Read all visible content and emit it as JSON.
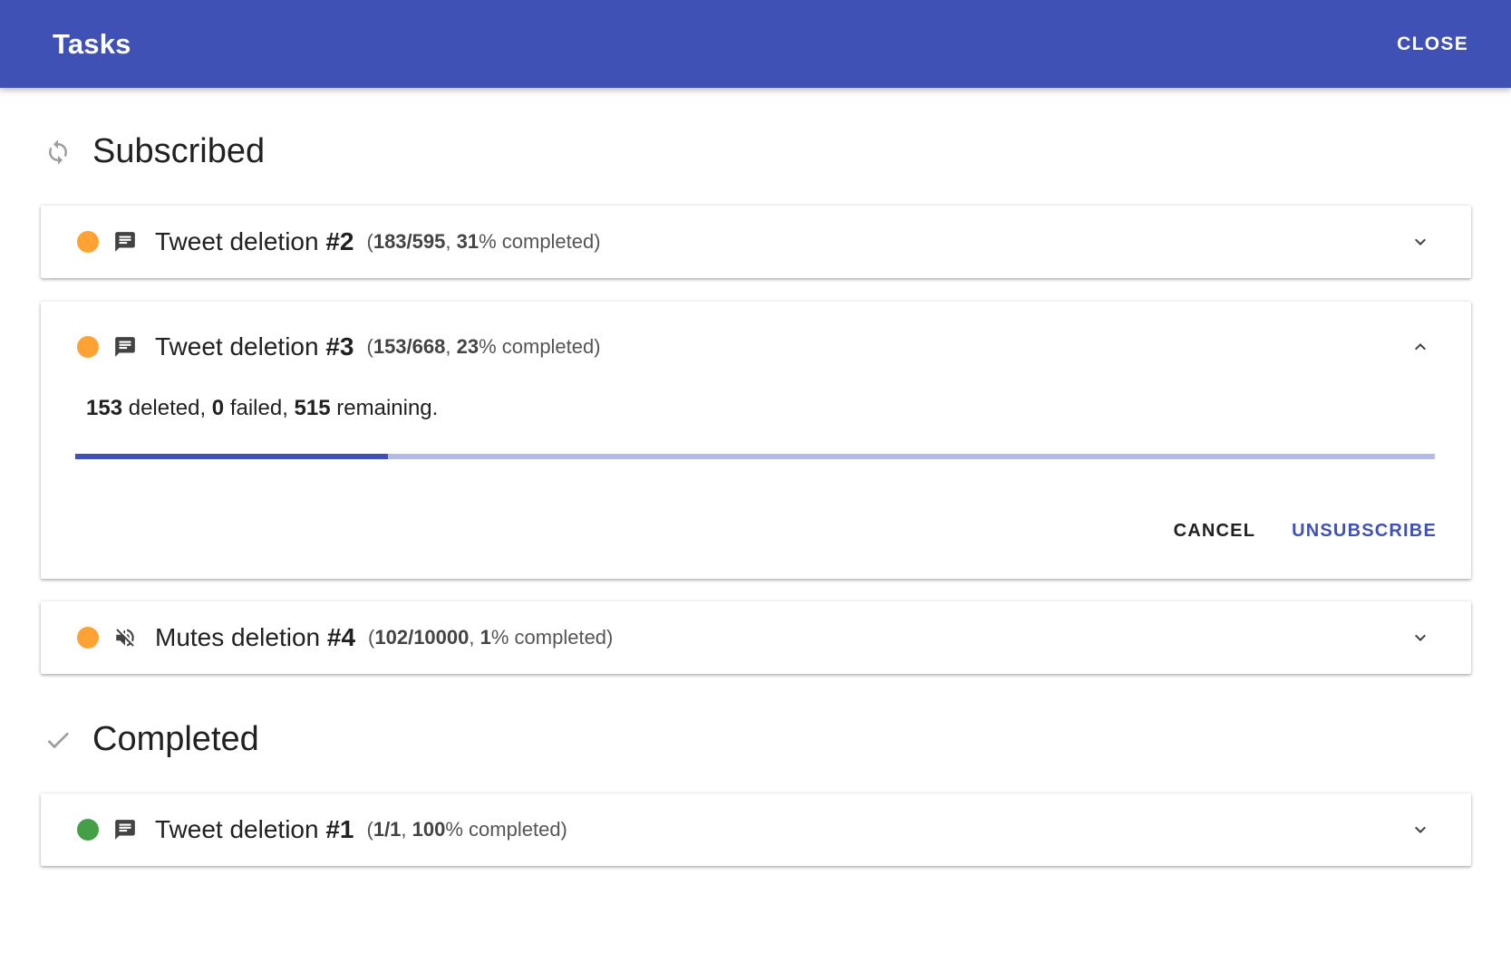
{
  "appbar": {
    "title": "Tasks",
    "close_label": "CLOSE"
  },
  "sections": {
    "subscribed": {
      "title": "Subscribed",
      "icon": "sync-icon"
    },
    "completed": {
      "title": "Completed",
      "icon": "check-icon"
    }
  },
  "colors": {
    "primary": "#3f51b5",
    "in_progress": "#ffa234",
    "done": "#43a047"
  },
  "tasks": {
    "t2": {
      "status": "in-progress",
      "icon": "message-icon",
      "name_prefix": "Tweet deletion ",
      "name_num": "#2",
      "done": "183/595",
      "percent": "31",
      "suffix": "% completed)",
      "expanded": false
    },
    "t3": {
      "status": "in-progress",
      "icon": "message-icon",
      "name_prefix": "Tweet deletion ",
      "name_num": "#3",
      "done": "153/668",
      "percent": "23",
      "suffix": "% completed)",
      "expanded": true,
      "details": {
        "deleted": "153",
        "deleted_label": " deleted, ",
        "failed": "0",
        "failed_label": " failed, ",
        "remaining": "515",
        "remaining_label": " remaining."
      },
      "progress_fraction": 0.23,
      "cancel_label": "CANCEL",
      "unsubscribe_label": "UNSUBSCRIBE"
    },
    "t4": {
      "status": "in-progress",
      "icon": "volume-off-icon",
      "name_prefix": "Mutes deletion ",
      "name_num": "#4",
      "done": "102/10000",
      "percent": "1",
      "suffix": "% completed)",
      "expanded": false
    },
    "t1": {
      "status": "completed",
      "icon": "message-icon",
      "name_prefix": "Tweet deletion ",
      "name_num": "#1",
      "done": "1/1",
      "percent": "100",
      "suffix": "% completed)",
      "expanded": false
    }
  }
}
